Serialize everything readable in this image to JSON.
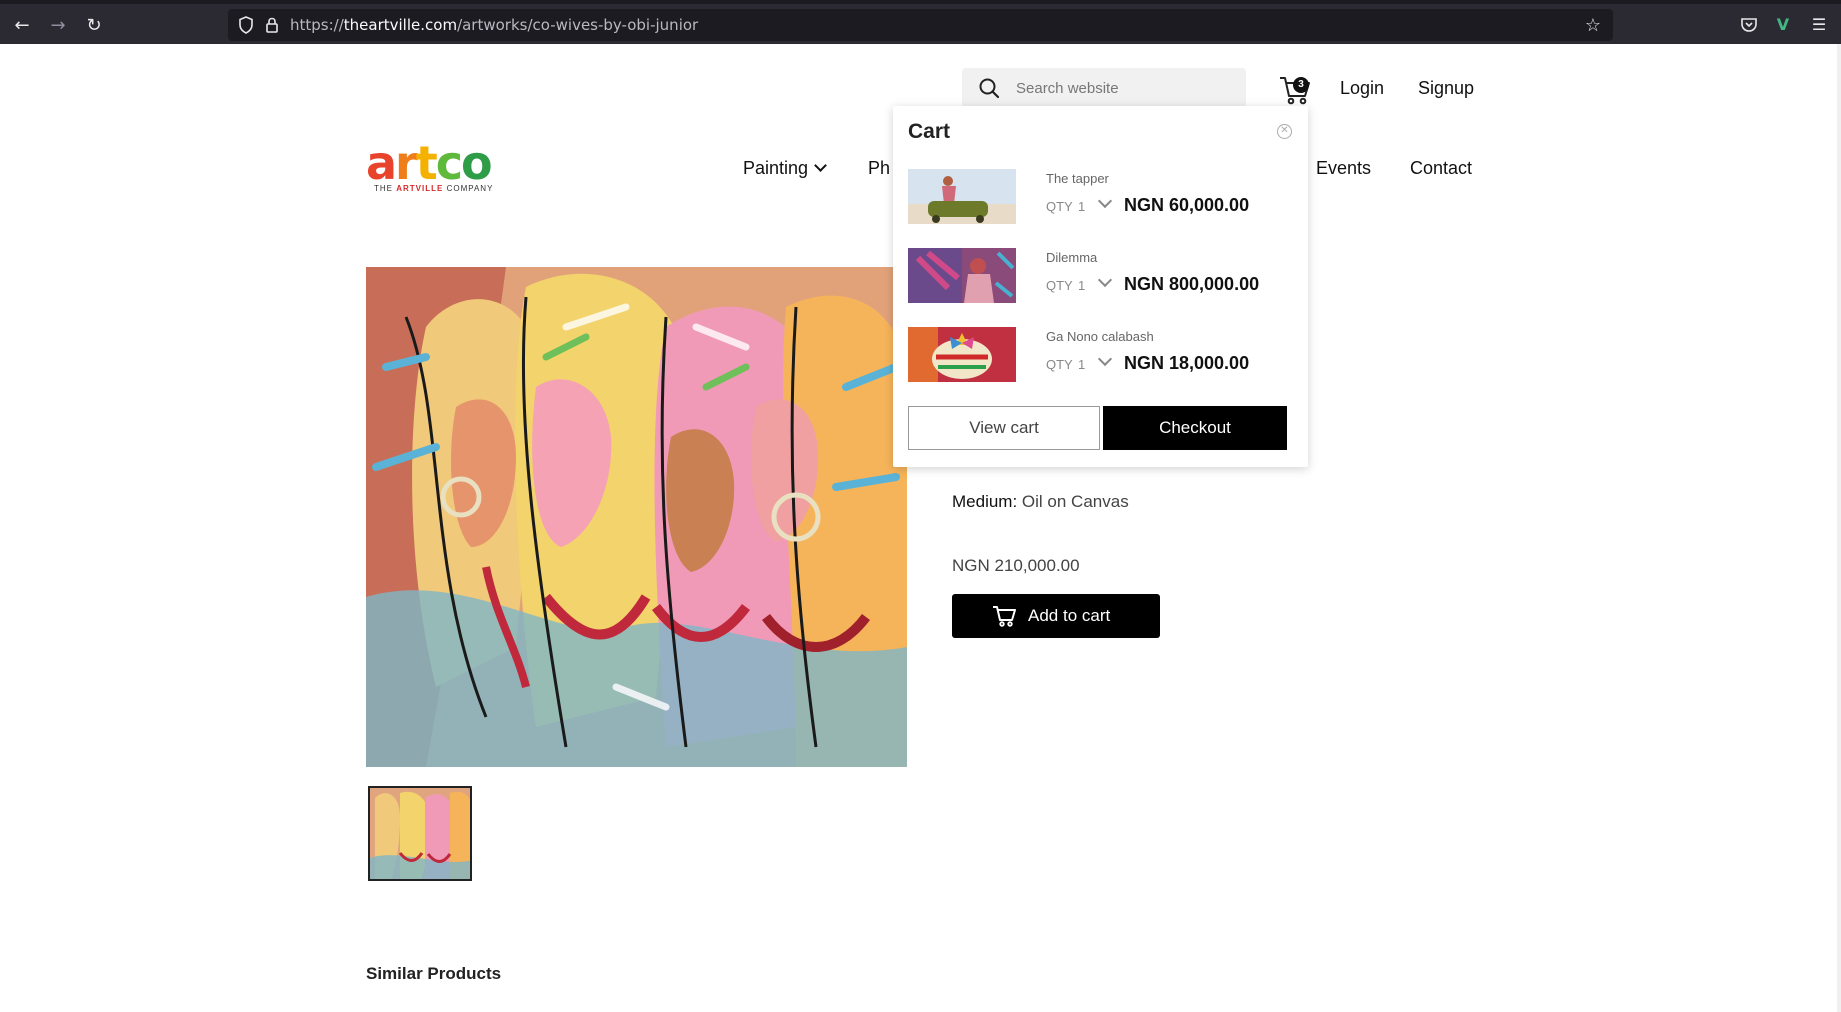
{
  "browser": {
    "url_host": "theartville.com",
    "url_prefix": "https://",
    "url_path": "/artworks/co-wives-by-obi-junior"
  },
  "header": {
    "search_placeholder": "Search website",
    "cart_count": "3",
    "login_label": "Login",
    "signup_label": "Signup"
  },
  "logo": {
    "letters": [
      "a",
      "r",
      "t",
      "c",
      "o"
    ],
    "letter_colors": [
      "#e8432b",
      "#ef7d1a",
      "#f5b100",
      "#5fb93b",
      "#2f9c47"
    ],
    "tag_prefix": "THE ",
    "tag_accent": "ARTVILLE",
    "tag_suffix": " COMPANY"
  },
  "nav": {
    "items": [
      {
        "label": "Painting",
        "has_dropdown": true
      },
      {
        "label": "Ph"
      },
      {
        "label": "Events"
      },
      {
        "label": "Contact"
      }
    ]
  },
  "product": {
    "medium_label": "Medium:",
    "medium_value": "Oil on Canvas",
    "price": "NGN 210,000.00",
    "add_to_cart_label": "Add to cart"
  },
  "similar_heading": "Similar Products",
  "cart": {
    "title": "Cart",
    "qty_label": "QTY",
    "items": [
      {
        "name": "The tapper",
        "qty": "1",
        "price": "NGN 60,000.00"
      },
      {
        "name": "Dilemma",
        "qty": "1",
        "price": "NGN 800,000.00"
      },
      {
        "name": "Ga Nono calabash",
        "qty": "1",
        "price": "NGN 18,000.00"
      }
    ],
    "view_cart_label": "View cart",
    "checkout_label": "Checkout"
  },
  "colors": {
    "chrome_bg": "#2b2a33",
    "button_black": "#000000"
  }
}
